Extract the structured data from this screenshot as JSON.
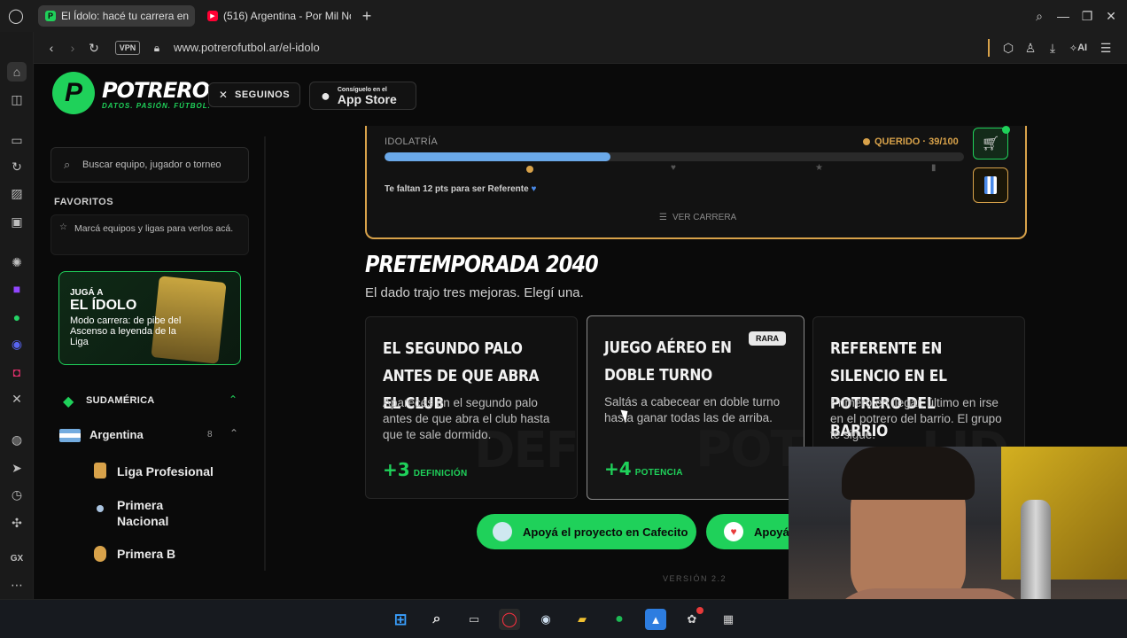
{
  "browser": {
    "tabs": [
      {
        "title": "El Ídolo: hacé tu carrera en",
        "active": true
      },
      {
        "title": "(516) Argentina - Por Mil No",
        "active": false
      }
    ],
    "new_tab": "+",
    "vpn": "VPN",
    "url": "www.potrerofutbol.ar/el-idolo",
    "ai": "AI"
  },
  "site": {
    "logo_name": "POTRERO",
    "logo_tagline": "DATOS. PASIÓN. FÚTBOL.",
    "follow_label": "SEGUINOS",
    "appstore_small": "Consíguelo en el",
    "appstore_big": "App Store"
  },
  "left": {
    "search_placeholder": "Buscar equipo, jugador o torneo",
    "favorites_title": "FAVORITOS",
    "favorites_hint": "Marcá equipos y ligas para verlos acá.",
    "promo": {
      "kicker": "JUGÁ A",
      "title": "EL ÍDOLO",
      "body": "Modo carrera: de pibe del Ascenso a leyenda de la Liga"
    },
    "region": "SUDAMÉRICA",
    "country": "Argentina",
    "country_count": "8",
    "leagues": [
      "Liga Profesional",
      "Primera Nacional",
      "Primera B"
    ]
  },
  "idolatria": {
    "label": "IDOLATRÍA",
    "status": "QUERIDO · 39/100",
    "progress": 0.39,
    "hint": "Te faltan 12 pts para ser Referente",
    "ver_carrera": "VER CARRERA"
  },
  "preseason": {
    "title": "PRETEMPORADA 2040",
    "subtitle": "El dado trajo tres mejoras. Elegí una.",
    "cards": [
      {
        "title": "El segundo palo antes de que abra el club",
        "body": "Aparecés en el segundo palo antes de que abra el club hasta que te sale dormido.",
        "bonus": "+3",
        "stat": "DEFINICIÓN",
        "ghost": "DEF",
        "badge": ""
      },
      {
        "title": "Juego aéreo en doble turno",
        "body": "Saltás a cabecear en doble turno hasta ganar todas las de arriba.",
        "bonus": "+4",
        "stat": "POTENCIA",
        "ghost": "POT",
        "badge": "RARA"
      },
      {
        "title": "Referente en silencio en el potrero del barrio",
        "body": "Primero en llegar, último en irse en el potrero del barrio. El grupo te sigue.",
        "bonus": "",
        "stat": "",
        "ghost": "LID",
        "badge": ""
      }
    ]
  },
  "support": {
    "cafecito": "Apoyá el proyecto en Cafecito",
    "second": "Apoyá"
  },
  "version": "VERSIÓN 2.2",
  "colors": {
    "accent": "#1fd15a",
    "gold": "#d8a24a",
    "bar": "#6aa8e8"
  }
}
